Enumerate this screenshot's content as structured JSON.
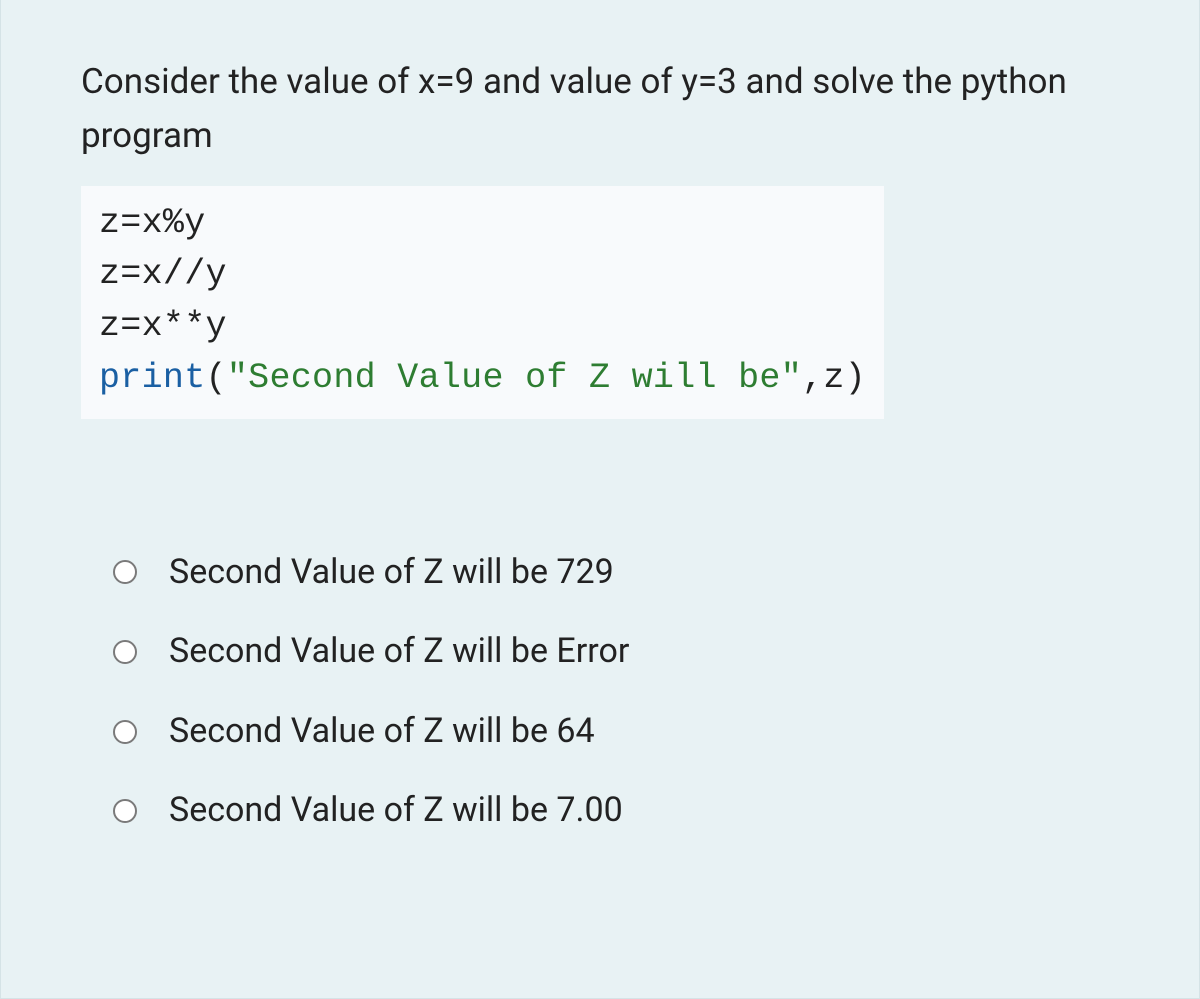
{
  "question": {
    "prompt": "Consider the value of x=9 and value of y=3 and solve the python program",
    "code": {
      "line1": "z=x%y",
      "line2": "z=x//y",
      "line3": "z=x**y",
      "line4_print": "print",
      "line4_open": "(",
      "line4_str": "\"Second Value of Z will be\"",
      "line4_rest": ",z)"
    }
  },
  "options": [
    {
      "label": "Second Value of Z will be 729"
    },
    {
      "label": "Second Value of Z will be Error"
    },
    {
      "label": "Second Value of Z will be 64"
    },
    {
      "label": "Second Value of Z will be 7.00"
    }
  ]
}
